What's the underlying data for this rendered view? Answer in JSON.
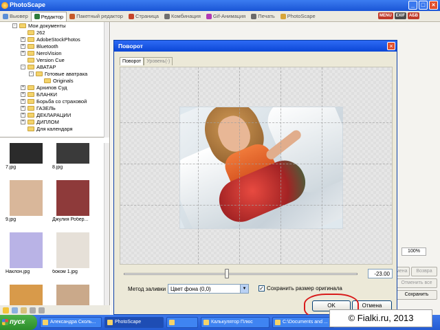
{
  "window": {
    "title": "PhotoScape"
  },
  "tabs": [
    {
      "label": "Вьювер",
      "color": "#5b8fd6"
    },
    {
      "label": "Редактор",
      "color": "#2f7c3b"
    },
    {
      "label": "Пакетный редактор",
      "color": "#c65b2b"
    },
    {
      "label": "Страница",
      "color": "#c6452b"
    },
    {
      "label": "Комбинация",
      "color": "#6f6f6f"
    },
    {
      "label": "Gif-Анимация",
      "color": "#b03ab5"
    },
    {
      "label": "Печать",
      "color": "#6b6b6b"
    },
    {
      "label": "PhotoScape",
      "color": "#d8a63a"
    }
  ],
  "badges": [
    {
      "label": "MENU",
      "color": "#c03a2b"
    },
    {
      "label": "EXIF",
      "color": "#4b4b4b"
    },
    {
      "label": "АБВ",
      "color": "#c03a2b"
    }
  ],
  "tree": [
    {
      "label": "Мои документы",
      "level": 0,
      "exp": "-"
    },
    {
      "label": "262",
      "level": 1,
      "exp": ""
    },
    {
      "label": "AdobeStockPhotos",
      "level": 1,
      "exp": "+"
    },
    {
      "label": "Bluetooth",
      "level": 1,
      "exp": "+"
    },
    {
      "label": "NeroVision",
      "level": 1,
      "exp": "+"
    },
    {
      "label": "Version Cue",
      "level": 1,
      "exp": ""
    },
    {
      "label": "АВАТАР",
      "level": 1,
      "exp": "-"
    },
    {
      "label": "Готовые аватрака",
      "level": 2,
      "exp": "-"
    },
    {
      "label": "Originals",
      "level": 3,
      "exp": ""
    },
    {
      "label": "Архипов Суд",
      "level": 1,
      "exp": "+"
    },
    {
      "label": "БЛАНКИ",
      "level": 1,
      "exp": "+"
    },
    {
      "label": "Борьба со страховой",
      "level": 1,
      "exp": "+"
    },
    {
      "label": "ГАЗЕЛЬ",
      "level": 1,
      "exp": "+"
    },
    {
      "label": "ДЕКЛАРАЦИИ",
      "level": 1,
      "exp": "+"
    },
    {
      "label": "ДИПЛОМ",
      "level": 1,
      "exp": "+"
    },
    {
      "label": "Для календаря",
      "level": 1,
      "exp": ""
    }
  ],
  "thumbs": [
    {
      "label": "7.jpg",
      "bg": "#2b2b2b"
    },
    {
      "label": "8.jpg",
      "bg": "#3a3a3a"
    },
    {
      "label": "9.jpg",
      "bg": "#d9b79a"
    },
    {
      "label": "Джулия Робер...",
      "bg": "#8e3a3a"
    },
    {
      "label": "Наклон.jpg",
      "bg": "#b9b3e6"
    },
    {
      "label": "боком 1.jpg",
      "bg": "#e6e0d8"
    },
    {
      "label": "",
      "bg": "#d89a4a"
    },
    {
      "label": "",
      "bg": "#caa98a"
    }
  ],
  "right_panel": {
    "zoom": "100%",
    "undo": "Отмена",
    "redo": "Возвра",
    "undo_all": "Отменить все",
    "save": "Сохранить"
  },
  "dialog": {
    "title": "Поворот",
    "tab_rotate": "Поворот",
    "tab_level": "Уровень(-)",
    "angle": "-23.00",
    "fill_label": "Метод заливки",
    "fill_value": "Цвет фона (0,0)",
    "keep_size_label": "Сохранить размер оригинала",
    "keep_size_checked": true,
    "ok": "OK",
    "cancel": "Отмена",
    "rotation_fraction": 0.44
  },
  "taskbar": {
    "start": "пуск",
    "tasks": [
      {
        "label": "Александра Сколь...",
        "active": false
      },
      {
        "label": "PhotoScape",
        "active": true
      },
      {
        "label": "",
        "active": false
      },
      {
        "label": "Калькулятор Плюс",
        "active": false
      },
      {
        "label": "C:\\Documents and ...",
        "active": false
      }
    ]
  },
  "watermark": "© Fialki.ru, 2013"
}
